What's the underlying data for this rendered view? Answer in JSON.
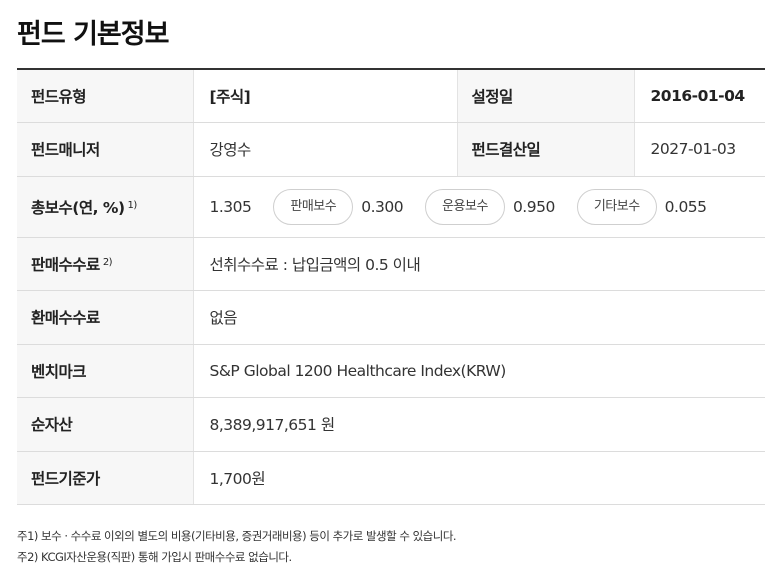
{
  "title": "펀드 기본정보",
  "rows": {
    "fund_type": {
      "label": "펀드유형",
      "value": "[주식]"
    },
    "inception": {
      "label": "설정일",
      "value": "2016-01-04"
    },
    "manager": {
      "label": "펀드매니저",
      "value": "강영수"
    },
    "settlement": {
      "label": "펀드결산일",
      "value": "2027-01-03"
    },
    "total_fee": {
      "label": "총보수(연, %)",
      "sup": "1)",
      "value": "1.305",
      "sales_label": "판매보수",
      "sales_value": "0.300",
      "mgmt_label": "운용보수",
      "mgmt_value": "0.950",
      "other_label": "기타보수",
      "other_value": "0.055"
    },
    "sales_commission": {
      "label": "판매수수료",
      "sup": "2)",
      "value": "선취수수료 : 납입금액의 0.5 이내"
    },
    "redemption_fee": {
      "label": "환매수수료",
      "value": "없음"
    },
    "benchmark": {
      "label": "벤치마크",
      "value": "S&P Global 1200 Healthcare Index(KRW)"
    },
    "net_assets": {
      "label": "순자산",
      "value": "8,389,917,651 원"
    },
    "nav": {
      "label": "펀드기준가",
      "value": "1,700원"
    }
  },
  "footnotes": [
    "주1) 보수 · 수수료 이외의 별도의 비용(기타비용, 증권거래비용) 등이 추가로 발생할 수 있습니다.",
    "주2) KCGI자산운용(직판) 통해 가입시 판매수수료 없습니다."
  ]
}
